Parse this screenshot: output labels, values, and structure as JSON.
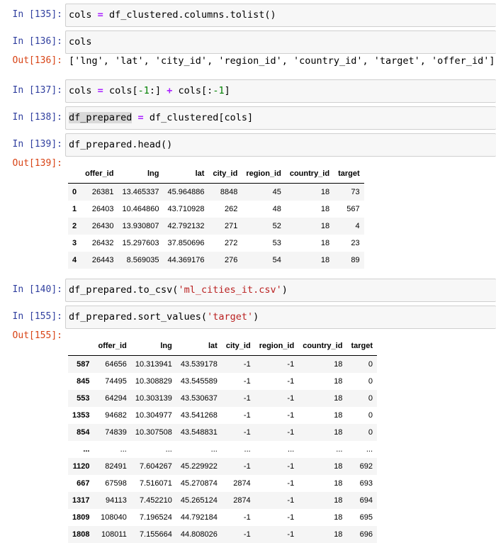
{
  "cells": {
    "c135": {
      "prompt": "In [135]:",
      "code": {
        "lhs": "cols",
        "eq": "=",
        "rhs": "df_clustered.columns.tolist()"
      }
    },
    "c136": {
      "prompt": "In [136]:",
      "code": "cols",
      "out_prompt": "Out[136]:",
      "output": "['lng', 'lat', 'city_id', 'region_id', 'country_id', 'target', 'offer_id']"
    },
    "c137": {
      "prompt": "In [137]:",
      "code": {
        "a": "cols",
        "eq": "=",
        "b": "cols[",
        "n1": "-1",
        "c": ":]",
        "plus": "+",
        "d": "cols[:",
        "n2": "-1",
        "e": "]"
      }
    },
    "c138": {
      "prompt": "In [138]:",
      "code": {
        "lhs": "df_prepared",
        "eq": "=",
        "rhs": "df_clustered[cols]"
      }
    },
    "c139": {
      "prompt": "In [139]:",
      "code": "df_prepared.head()",
      "out_prompt": "Out[139]:",
      "table": {
        "columns": [
          "",
          "offer_id",
          "lng",
          "lat",
          "city_id",
          "region_id",
          "country_id",
          "target"
        ],
        "rows": [
          [
            "0",
            "26381",
            "13.465337",
            "45.964886",
            "8848",
            "45",
            "18",
            "73"
          ],
          [
            "1",
            "26403",
            "10.464860",
            "43.710928",
            "262",
            "48",
            "18",
            "567"
          ],
          [
            "2",
            "26430",
            "13.930807",
            "42.792132",
            "271",
            "52",
            "18",
            "4"
          ],
          [
            "3",
            "26432",
            "15.297603",
            "37.850696",
            "272",
            "53",
            "18",
            "23"
          ],
          [
            "4",
            "26443",
            "8.569035",
            "44.369176",
            "276",
            "54",
            "18",
            "89"
          ]
        ]
      }
    },
    "c140": {
      "prompt": "In [140]:",
      "code": {
        "a": "df_prepared.to_csv(",
        "s": "'ml_cities_it.csv'",
        "b": ")"
      }
    },
    "c155": {
      "prompt": "In [155]:",
      "code": {
        "a": "df_prepared.sort_values(",
        "s": "'target'",
        "b": ")"
      },
      "out_prompt": "Out[155]:",
      "table": {
        "columns": [
          "",
          "offer_id",
          "lng",
          "lat",
          "city_id",
          "region_id",
          "country_id",
          "target"
        ],
        "rows": [
          [
            "587",
            "64656",
            "10.313941",
            "43.539178",
            "-1",
            "-1",
            "18",
            "0"
          ],
          [
            "845",
            "74495",
            "10.308829",
            "43.545589",
            "-1",
            "-1",
            "18",
            "0"
          ],
          [
            "553",
            "64294",
            "10.303139",
            "43.530637",
            "-1",
            "-1",
            "18",
            "0"
          ],
          [
            "1353",
            "94682",
            "10.304977",
            "43.541268",
            "-1",
            "-1",
            "18",
            "0"
          ],
          [
            "854",
            "74839",
            "10.307508",
            "43.548831",
            "-1",
            "-1",
            "18",
            "0"
          ],
          [
            "...",
            "...",
            "...",
            "...",
            "...",
            "...",
            "...",
            "..."
          ],
          [
            "1120",
            "82491",
            "7.604267",
            "45.229922",
            "-1",
            "-1",
            "18",
            "692"
          ],
          [
            "667",
            "67598",
            "7.516071",
            "45.270874",
            "2874",
            "-1",
            "18",
            "693"
          ],
          [
            "1317",
            "94113",
            "7.452210",
            "45.265124",
            "2874",
            "-1",
            "18",
            "694"
          ],
          [
            "1809",
            "108040",
            "7.196524",
            "44.792184",
            "-1",
            "-1",
            "18",
            "695"
          ],
          [
            "1808",
            "108011",
            "7.155664",
            "44.808026",
            "-1",
            "-1",
            "18",
            "696"
          ]
        ]
      }
    }
  }
}
